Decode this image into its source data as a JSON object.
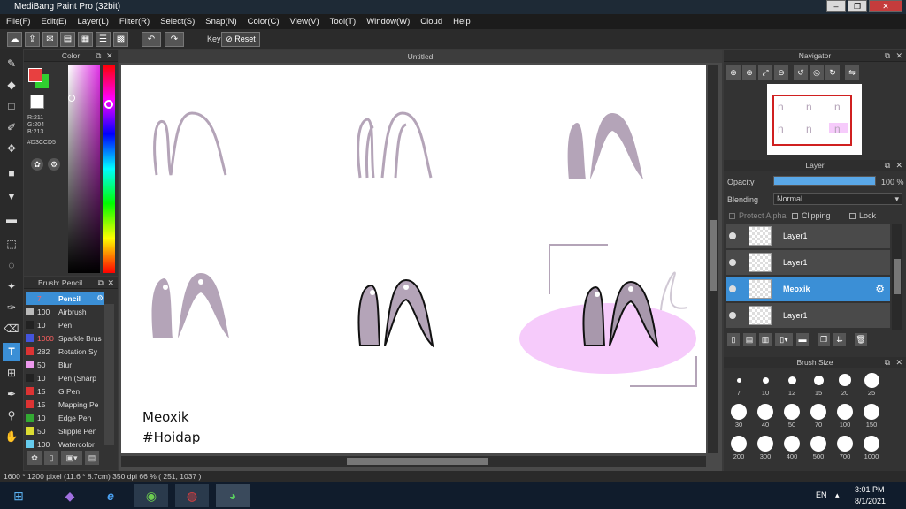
{
  "window": {
    "title": "MediBang Paint Pro (32bit)",
    "buttons": [
      "–",
      "❐",
      "✕"
    ]
  },
  "menu": [
    "File(F)",
    "Edit(E)",
    "Layer(L)",
    "Filter(R)",
    "Select(S)",
    "Snap(N)",
    "Color(C)",
    "View(V)",
    "Tool(T)",
    "Window(W)",
    "Cloud",
    "Help"
  ],
  "toolbar": {
    "key_label": "Key",
    "reset_label": "Reset"
  },
  "color_panel": {
    "title": "Color",
    "r": "R:211",
    "g": "G:204",
    "b": "B:213",
    "hex": "#D3CCD5",
    "fg": "#e84040",
    "bg": "#30d030"
  },
  "brush_panel": {
    "title": "Brush: Pencil",
    "items": [
      {
        "size": "7",
        "name": "Pencil",
        "color": "#3b8fd6"
      },
      {
        "size": "100",
        "name": "Airbrush",
        "color": "#bbbbbb"
      },
      {
        "size": "10",
        "name": "Pen",
        "color": "#222222"
      },
      {
        "size": "1000",
        "name": "Sparkle Brus",
        "color": "#4455dd"
      },
      {
        "size": "282",
        "name": "Rotation Sy",
        "color": "#dd3333"
      },
      {
        "size": "50",
        "name": "Blur",
        "color": "#ee99ee"
      },
      {
        "size": "10",
        "name": "Pen (Sharp",
        "color": "#222222"
      },
      {
        "size": "15",
        "name": "G Pen",
        "color": "#dd3333"
      },
      {
        "size": "15",
        "name": "Mapping Pe",
        "color": "#dd3333"
      },
      {
        "size": "10",
        "name": "Edge Pen",
        "color": "#33aa33"
      },
      {
        "size": "50",
        "name": "Stipple Pen",
        "color": "#dddd33"
      },
      {
        "size": "100",
        "name": "Watercolor",
        "color": "#66ccee"
      }
    ]
  },
  "canvas": {
    "title": "Untitled",
    "text_line1": "Meoxik",
    "text_line2": "#Hoidap"
  },
  "navigator": {
    "title": "Navigator"
  },
  "layer_panel": {
    "title": "Layer",
    "opacity_label": "Opacity",
    "opacity_value": "100 %",
    "opacity_fraction": 1.0,
    "blending_label": "Blending",
    "blending_value": "Normal",
    "protect_alpha": "Protect Alpha",
    "clipping": "Clipping",
    "lock": "Lock",
    "layers": [
      {
        "name": "Layer1",
        "selected": false
      },
      {
        "name": "Layer1",
        "selected": false
      },
      {
        "name": "Meoxik",
        "selected": true
      },
      {
        "name": "Layer1",
        "selected": false
      }
    ]
  },
  "brush_size_panel": {
    "title": "Brush Size",
    "sizes": [
      "7",
      "10",
      "12",
      "15",
      "20",
      "25",
      "30",
      "40",
      "50",
      "70",
      "100",
      "150",
      "200",
      "300",
      "400",
      "500",
      "700",
      "1000"
    ]
  },
  "status": "1600 * 1200 pixel   (11.6 * 8.7cm)   350 dpi   66 %   ( 251, 1037 )",
  "taskbar": {
    "lang": "EN",
    "time": "3:01 PM",
    "date": "8/1/2021"
  }
}
